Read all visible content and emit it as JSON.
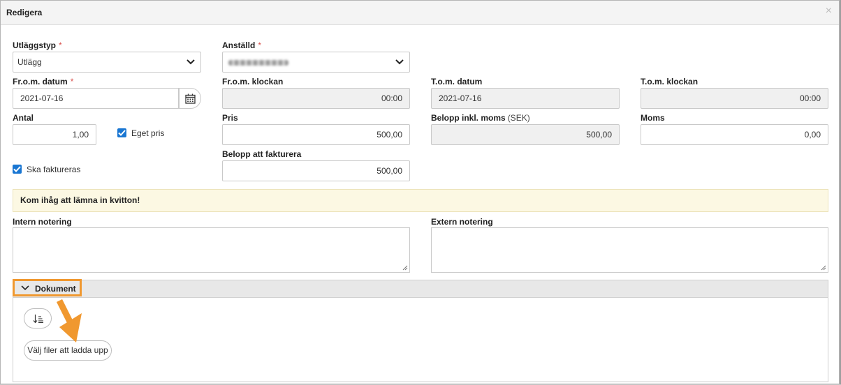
{
  "modal": {
    "title": "Redigera",
    "close_label": "×"
  },
  "form": {
    "expense_type": {
      "label": "Utläggstyp",
      "required": "*",
      "value": "Utlägg"
    },
    "employee": {
      "label": "Anställd",
      "required": "*"
    },
    "from_date": {
      "label": "Fr.o.m. datum",
      "required": "*",
      "value": "2021-07-16"
    },
    "from_time": {
      "label": "Fr.o.m. klockan",
      "value": "00:00"
    },
    "to_date": {
      "label": "T.o.m. datum",
      "value": "2021-07-16"
    },
    "to_time": {
      "label": "T.o.m. klockan",
      "value": "00:00"
    },
    "quantity": {
      "label": "Antal",
      "value": "1,00"
    },
    "own_price": {
      "label": "Eget pris",
      "checked": true
    },
    "price": {
      "label": "Pris",
      "value": "500,00"
    },
    "amount_incl_vat": {
      "label": "Belopp inkl. moms",
      "unit": "(SEK)",
      "value": "500,00"
    },
    "vat": {
      "label": "Moms",
      "value": "0,00"
    },
    "invoice_amount": {
      "label": "Belopp att fakturera",
      "value": "500,00"
    },
    "to_be_invoiced": {
      "label": "Ska faktureras",
      "checked": true
    },
    "notice": "Kom ihåg att lämna in kvitton!",
    "internal_note": {
      "label": "Intern notering",
      "value": ""
    },
    "external_note": {
      "label": "Extern notering",
      "value": ""
    }
  },
  "documents": {
    "title": "Dokument",
    "sort_icon": "sort-icon",
    "upload_label": "Välj filer att ladda upp"
  },
  "colors": {
    "accent": "#1976d2",
    "highlight": "#f0982f",
    "notice_bg": "#fcf8e3",
    "required": "#d9534f"
  }
}
